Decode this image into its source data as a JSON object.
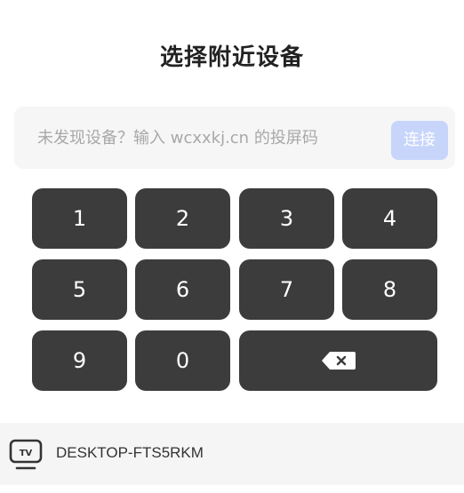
{
  "header": {
    "title": "选择附近设备"
  },
  "code_entry": {
    "placeholder": "未发现设备？输入 wcxxkj.cn 的投屏码",
    "value": "",
    "connect_label": "连接",
    "connect_color": "#c7d5fb"
  },
  "keypad": {
    "keys": [
      "1",
      "2",
      "3",
      "4",
      "5",
      "6",
      "7",
      "8",
      "9",
      "0"
    ],
    "backspace_icon": "backspace-icon",
    "key_color": "#3c3c3c"
  },
  "devices": [
    {
      "name": "DESKTOP-FTS5RKM",
      "icon": "tv-icon",
      "icon_label": "TV"
    }
  ]
}
